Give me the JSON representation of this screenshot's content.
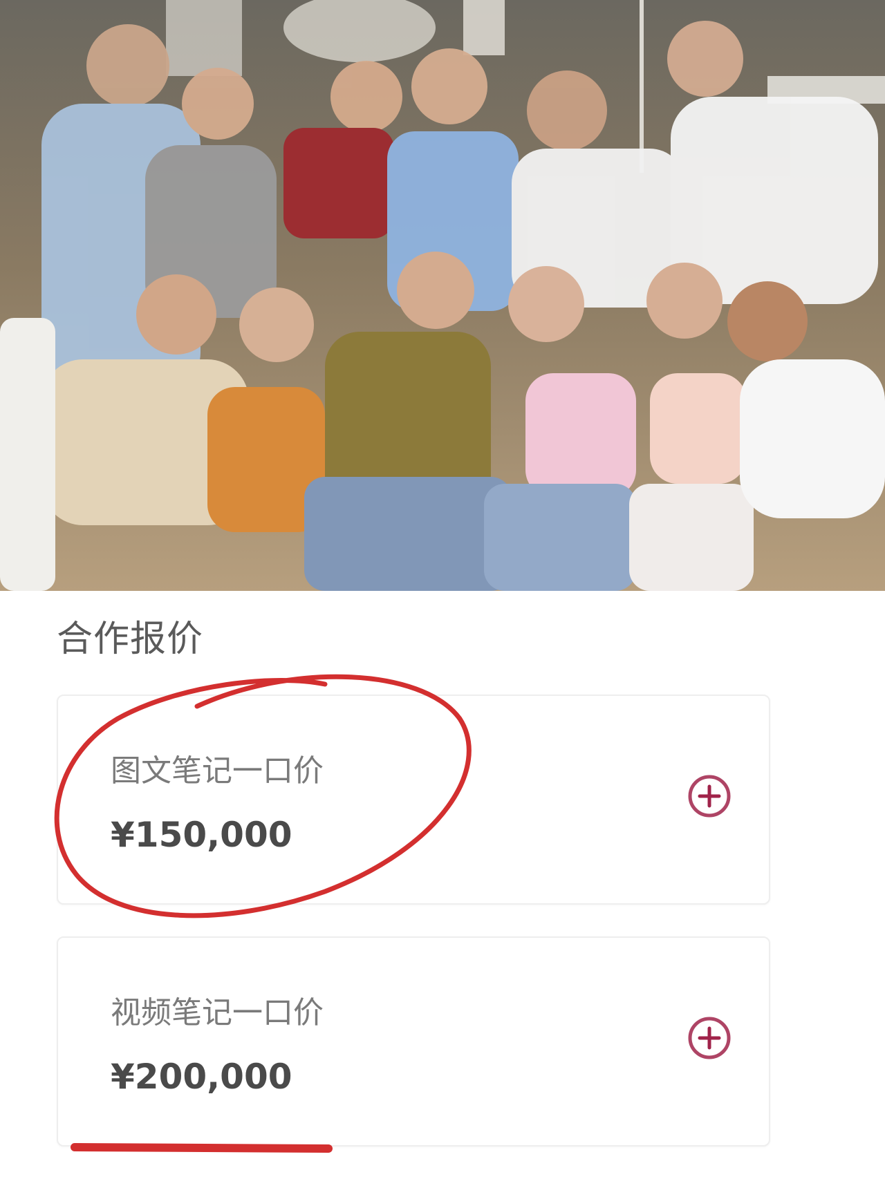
{
  "section_title": "合作报价",
  "quotes": [
    {
      "label": "图文笔记一口价",
      "price": "¥150,000"
    },
    {
      "label": "视频笔记一口价",
      "price": "¥200,000"
    }
  ],
  "icons": {
    "add": "plus-circle-icon"
  },
  "colors": {
    "accent_icon": "#a0234a",
    "annotation_red": "#d32f2f",
    "title_text": "#5a5a5a",
    "label_text": "#7a7a7a",
    "price_text": "#4a4a4a"
  }
}
